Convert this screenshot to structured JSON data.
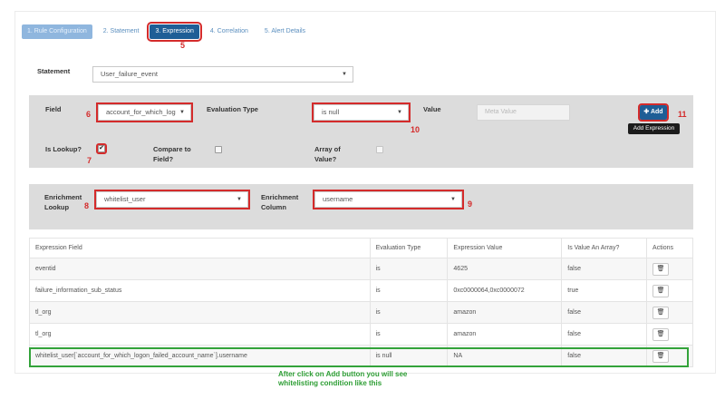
{
  "tabs": [
    {
      "label": "1. Rule Configuration"
    },
    {
      "label": "2. Statement"
    },
    {
      "label": "3. Expression"
    },
    {
      "label": "4. Correlation"
    },
    {
      "label": "5. Alert Details"
    }
  ],
  "statement": {
    "label": "Statement",
    "value": "User_failure_event"
  },
  "expression_panel": {
    "field_label": "Field",
    "field_value": "account_for_which_log",
    "evaluation_label": "Evaluation Type",
    "evaluation_value": "is null",
    "value_label": "Value",
    "value_placeholder": "Meta Value",
    "add_label": "✚ Add",
    "add_tooltip": "Add Expression",
    "is_lookup_label": "Is Lookup?",
    "is_lookup_checked": true,
    "compare_label_1": "Compare to",
    "compare_label_2": "Field?",
    "array_label_1": "Array of",
    "array_label_2": "Value?"
  },
  "enrichment_panel": {
    "lookup_label_1": "Enrichment",
    "lookup_label_2": "Lookup",
    "lookup_value": "whitelist_user",
    "column_label_1": "Enrichment",
    "column_label_2": "Column",
    "column_value": "username"
  },
  "callouts": {
    "c5": "5",
    "c6": "6",
    "c7": "7",
    "c8": "8",
    "c9": "9",
    "c10": "10",
    "c11": "11"
  },
  "table": {
    "headers": [
      "Expression Field",
      "Evaluation Type",
      "Expression Value",
      "Is Value An Array?",
      "Actions"
    ],
    "rows": [
      {
        "field": "eventid",
        "eval": "is",
        "value": "4625",
        "array": "false"
      },
      {
        "field": "failure_information_sub_status",
        "eval": "is",
        "value": "0xc0000064,0xc0000072",
        "array": "true"
      },
      {
        "field": "tl_org",
        "eval": "is",
        "value": "amazon",
        "array": "false"
      },
      {
        "field": "tl_org",
        "eval": "is",
        "value": "amazon",
        "array": "false"
      },
      {
        "field": "whitelist_user[`account_for_which_logon_failed_account_name`].username",
        "eval": "is null",
        "value": "NA",
        "array": "false"
      }
    ],
    "trash_icon": "🗑"
  },
  "annotation": {
    "line1": "After click on Add  button you will see",
    "line2": "whitelisting condition like this"
  },
  "colors": {
    "accent": "#1e5e96",
    "highlight_red": "#d42b2b",
    "highlight_green": "#33a33a",
    "panel_gray": "#dcdcdc"
  }
}
